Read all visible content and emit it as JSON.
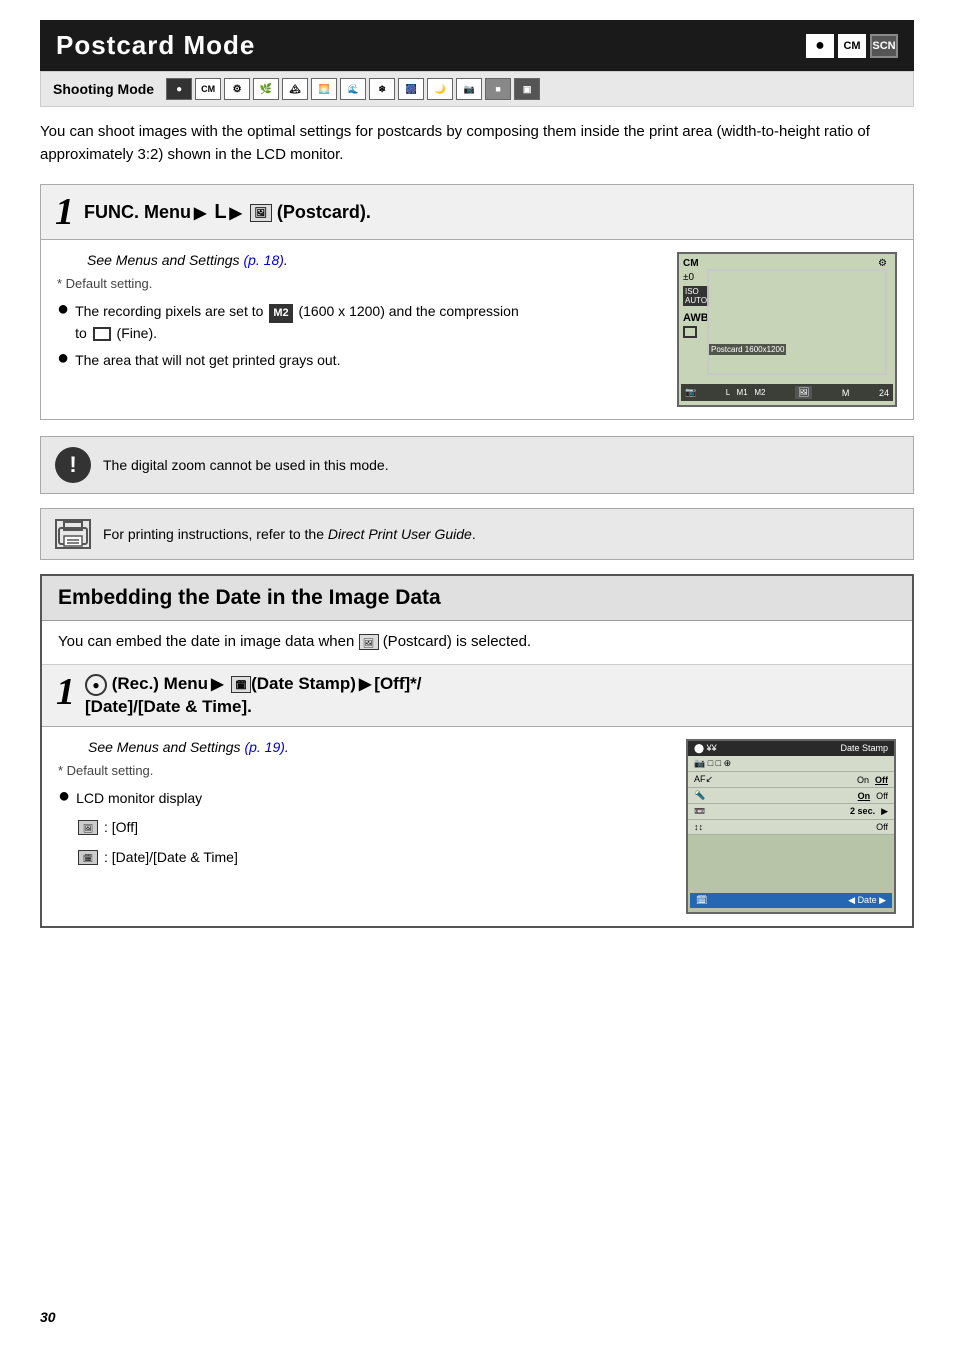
{
  "page": {
    "number": "30"
  },
  "postcard_section": {
    "title": "Postcard Mode",
    "header_icons": {
      "icon1": "●",
      "icon2": "CM",
      "icon3": "SCN"
    },
    "shooting_mode_label": "Shooting Mode",
    "intro_text": "You can shoot images with the optimal settings for postcards by composing them inside the print area (width-to-height ratio of approximately 3:2) shown in the LCD monitor.",
    "step1": {
      "number": "1",
      "instruction": "FUNC. Menu ▶ L ▶ 🖼 (Postcard).",
      "see_also": "See Menus and Settings (p. 18).",
      "see_also_link": "p. 18",
      "default_setting_label": "* Default setting.",
      "bullets": [
        "The recording pixels are set to M2 (1600 x 1200) and the compression to □ (Fine).",
        "The area that will not get printed grays out."
      ]
    },
    "note_zoom": "The digital zoom cannot be used in this mode.",
    "note_print": "For printing instructions, refer to the Direct Print User Guide.",
    "note_print_italic": "Direct Print User Guide"
  },
  "embedding_section": {
    "title": "Embedding the Date in the Image Data",
    "intro_text1": "You can embed the date in image data when",
    "intro_text2": "(Postcard) is selected.",
    "step1": {
      "number": "1",
      "instruction_part1": "● (Rec.) Menu ▶ 🗓(Date Stamp) ▶ [Off]*/",
      "instruction_part2": "[Date]/[Date & Time].",
      "see_also": "See Menus and Settings (p. 19).",
      "see_also_link": "p. 19",
      "default_setting_label": "* Default setting.",
      "bullets": [
        "LCD monitor display"
      ],
      "sub_bullets": [
        "🖼: [Off]",
        "🗓: [Date]/[Date & Time]"
      ]
    },
    "date_lcd": {
      "header_left": "⬤ ¥¥",
      "header_right": "Date Stamp",
      "rows": [
        {
          "icon": "📷",
          "icons_extra": "□□□",
          "values": ""
        },
        {
          "label": "AF↙",
          "val1": "On",
          "val2": "Off",
          "active": 2
        },
        {
          "label": "🔦",
          "val1": "On",
          "val2": "Off",
          "active": 1
        },
        {
          "label": "📼",
          "val1": "2 sec.",
          "arrow": "▶",
          "active": 1
        },
        {
          "label": "↕↕",
          "val1": "Off",
          "active": 0
        }
      ],
      "bottom_label": "🗓",
      "bottom_value": "◀Date▶"
    }
  }
}
